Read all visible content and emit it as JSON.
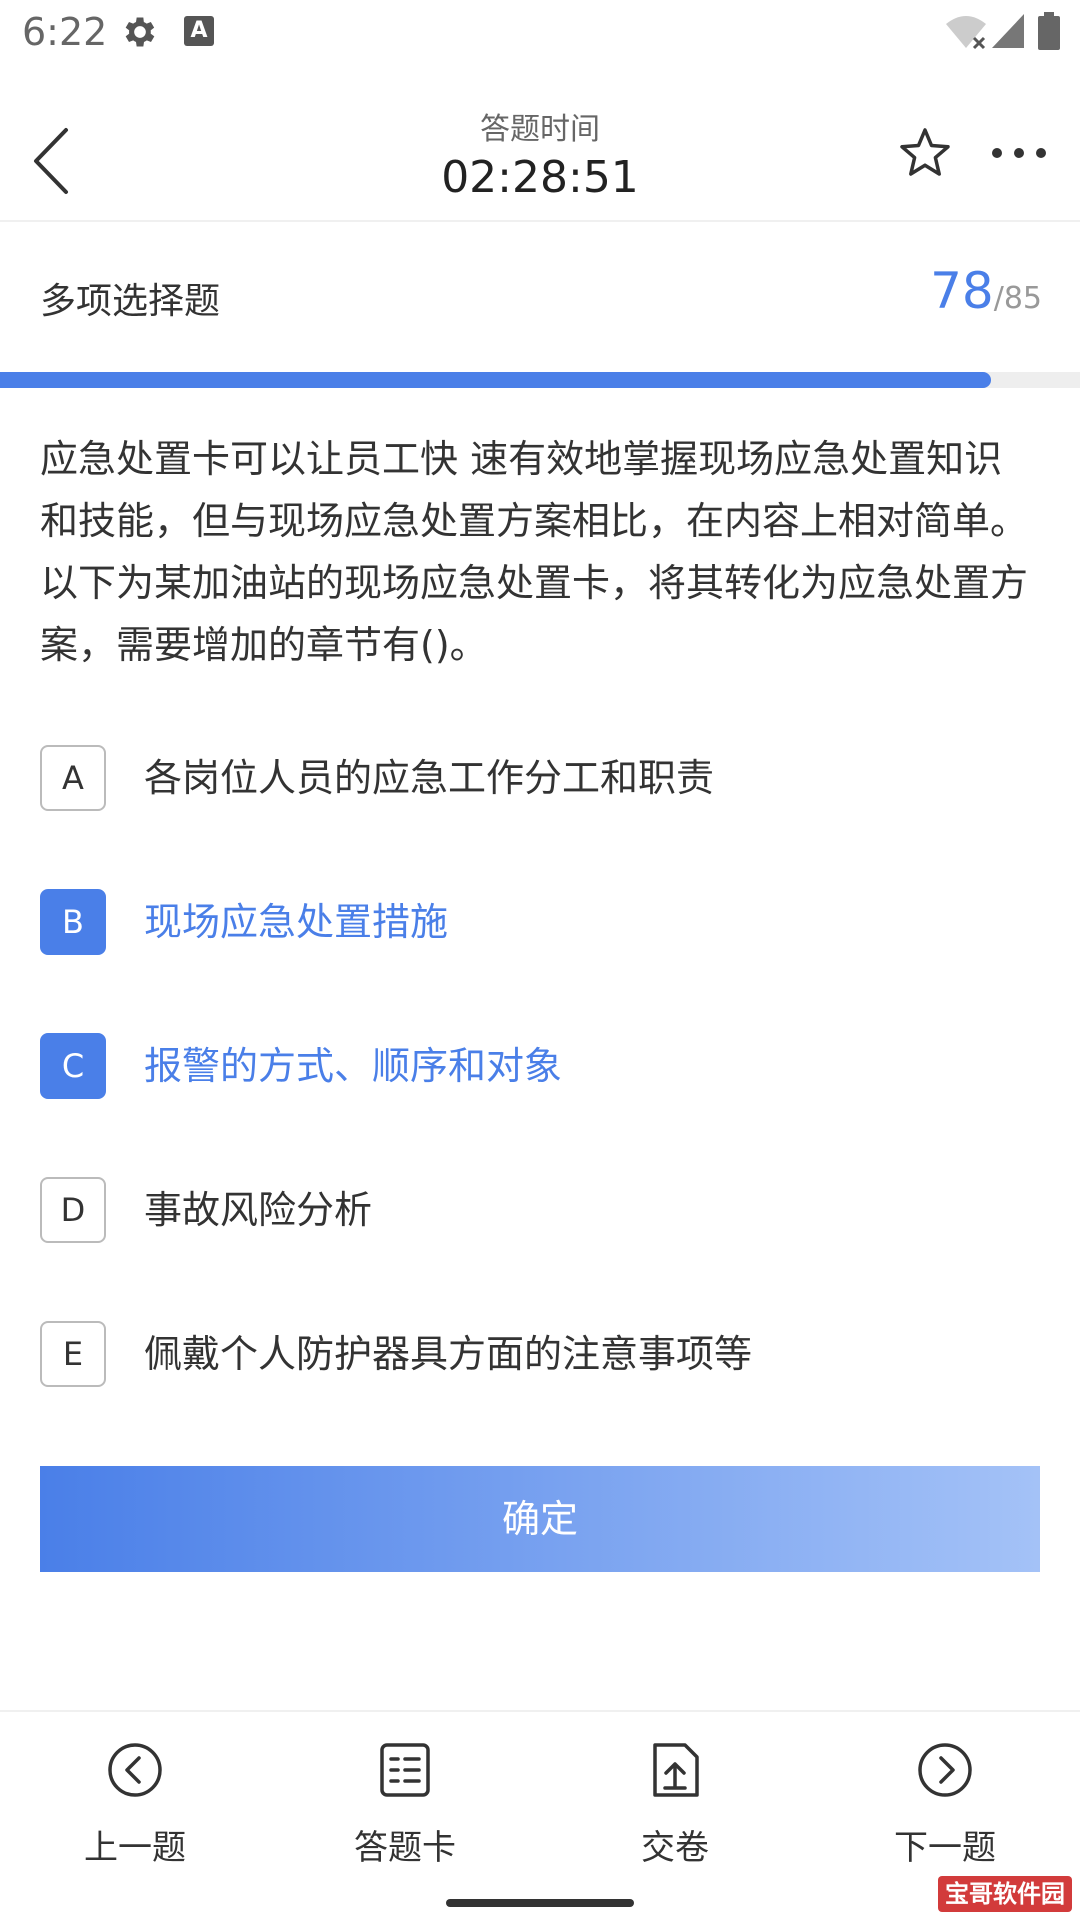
{
  "status_bar": {
    "time": "6:22"
  },
  "header": {
    "label": "答题时间",
    "timer": "02:28:51"
  },
  "question_type": "多项选择题",
  "progress": {
    "current": "78",
    "total": "/85",
    "fraction": 0.918
  },
  "question": {
    "text": "应急处置卡可以让员工快 速有效地掌握现场应急处置知识和技能，但与现场应急处置方案相比，在内容上相对简单。以下为某加油站的现场应急处置卡，将其转化为应急处置方案，需要增加的章节有()。"
  },
  "options": [
    {
      "letter": "A",
      "text": "各岗位人员的应急工作分工和职责",
      "selected": false
    },
    {
      "letter": "B",
      "text": "现场应急处置措施",
      "selected": true
    },
    {
      "letter": "C",
      "text": "报警的方式、顺序和对象",
      "selected": true
    },
    {
      "letter": "D",
      "text": "事故风险分析",
      "selected": false
    },
    {
      "letter": "E",
      "text": "佩戴个人防护器具方面的注意事项等",
      "selected": false
    }
  ],
  "confirm_label": "确定",
  "bottom_nav": [
    {
      "label": "上一题",
      "icon": "chevron-left-circle-icon"
    },
    {
      "label": "答题卡",
      "icon": "answer-sheet-icon"
    },
    {
      "label": "交卷",
      "icon": "submit-paper-icon"
    },
    {
      "label": "下一题",
      "icon": "chevron-right-circle-icon"
    }
  ],
  "watermark": "宝哥软件园",
  "colors": {
    "accent": "#4a7fe8",
    "accent_light": "#a4c2f7",
    "text": "#333333",
    "muted": "#999999"
  }
}
